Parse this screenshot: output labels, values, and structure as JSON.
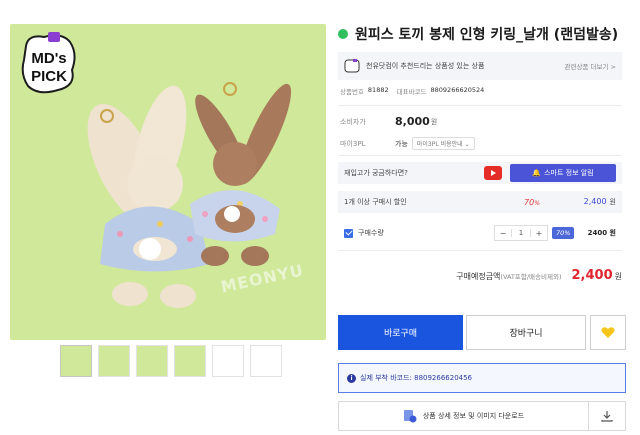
{
  "badge": {
    "text_line1": "MD's",
    "text_line2": "PICK"
  },
  "watermark": "MEONYU",
  "thumbnails_count": 6,
  "product": {
    "title": "원피스 토끼 봉제 인형 키링_날개 (랜덤발송)"
  },
  "recommend": {
    "text": "천유닷컴이 추천드리는 상품성 있는 상품",
    "more": "관련상품 더보기 >"
  },
  "meta": {
    "code_label": "상품번호",
    "code_value": "81882",
    "barcode_label": "대표바코드",
    "barcode_value": "8809266620524"
  },
  "price": {
    "label": "소비자가",
    "value": "8,000",
    "unit": "원"
  },
  "shipping": {
    "label": "마이3PL",
    "value": "가능",
    "select": "마이3PL 비용안내"
  },
  "restock": {
    "text": "재입고가 궁금하다면?",
    "smart_button": "스마트 정보 알림"
  },
  "discount": {
    "label": "1개 이상 구매시 할인",
    "rate": "70",
    "rate_unit": "%",
    "price": "2,400",
    "unit": "원"
  },
  "quantity": {
    "label": "구매수량",
    "minus": "−",
    "value": "1",
    "plus": "+",
    "badge": "70%",
    "price": "2400 원"
  },
  "total": {
    "label": "구매예정금액",
    "note": "(VAT포함/배송비제외)",
    "value": "2,400",
    "unit": "원"
  },
  "buttons": {
    "buy": "바로구매",
    "cart": "장바구니"
  },
  "barcode_notice": "실제 부착 바코드: 8809266620456",
  "download": {
    "label": "상품 상세 정보 및 이미지 다운로드"
  },
  "colors": {
    "accent_blue": "#1a55e0",
    "price_red": "#e0262f",
    "status_green": "#2fbf5f",
    "product_bg": "#cfe89a"
  }
}
